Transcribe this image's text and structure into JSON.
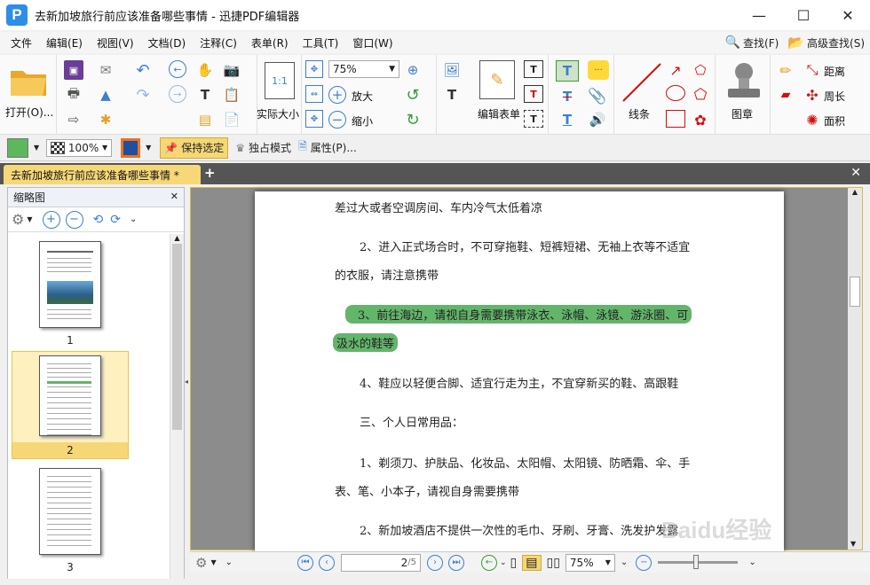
{
  "window": {
    "title": "去新加坡旅行前应该准备哪些事情 - 迅捷PDF编辑器",
    "logo_letter": "P"
  },
  "window_buttons": [
    "—",
    "☐",
    "✕"
  ],
  "menu": [
    "文件",
    "编辑(E)",
    "视图(V)",
    "文档(D)",
    "注释(C)",
    "表单(R)",
    "工具(T)",
    "窗口(W)"
  ],
  "menu_right": {
    "find": "查找(F)",
    "advanced_find": "高级查找(S)"
  },
  "ribbon": {
    "open": "打开(O)...",
    "actual_size": "实际大小",
    "zoom_value": "75%",
    "zoom_in": "放大",
    "zoom_out": "缩小",
    "edit_form": "编辑表单",
    "line": "线条",
    "stamp": "图章",
    "distance": "距离",
    "perimeter": "周长",
    "area": "面积",
    "fit_page_icon_text": "1:1"
  },
  "toolbar2": {
    "opacity": "100%",
    "keep_selected": "保持选定",
    "exclusive_mode": "独占模式",
    "properties": "属性(P)..."
  },
  "tab": {
    "label": "去新加坡旅行前应该准备哪些事情 *"
  },
  "sidebar": {
    "title": "缩略图",
    "pages": [
      "1",
      "2",
      "3"
    ]
  },
  "document": {
    "lines": [
      "差过大或者空调房间、车内冷气太低着凉",
      "2、进入正式场合时，不可穿拖鞋、短裤短裙、无袖上衣等不适宜",
      "的衣服，请注意携带",
      "3、前往海边，请视自身需要携带泳衣、泳帽、泳镜、游泳圈、可",
      "汲水的鞋等",
      "4、鞋应以轻便合脚、适宜行走为主，不宜穿新买的鞋、高跟鞋",
      "三、个人日常用品：",
      "1、剃须刀、护肤品、化妆品、太阳帽、太阳镜、防晒霜、伞、手",
      "表、笔、小本子，请视自身需要携带",
      "2、新加坡酒店不提供一次性的毛巾、牙刷、牙膏、洗发护发露"
    ],
    "highlight_color": "#63b56a"
  },
  "status": {
    "page_current": "2",
    "page_total": "/5",
    "zoom": "75%"
  },
  "watermark": "Baidu经验"
}
